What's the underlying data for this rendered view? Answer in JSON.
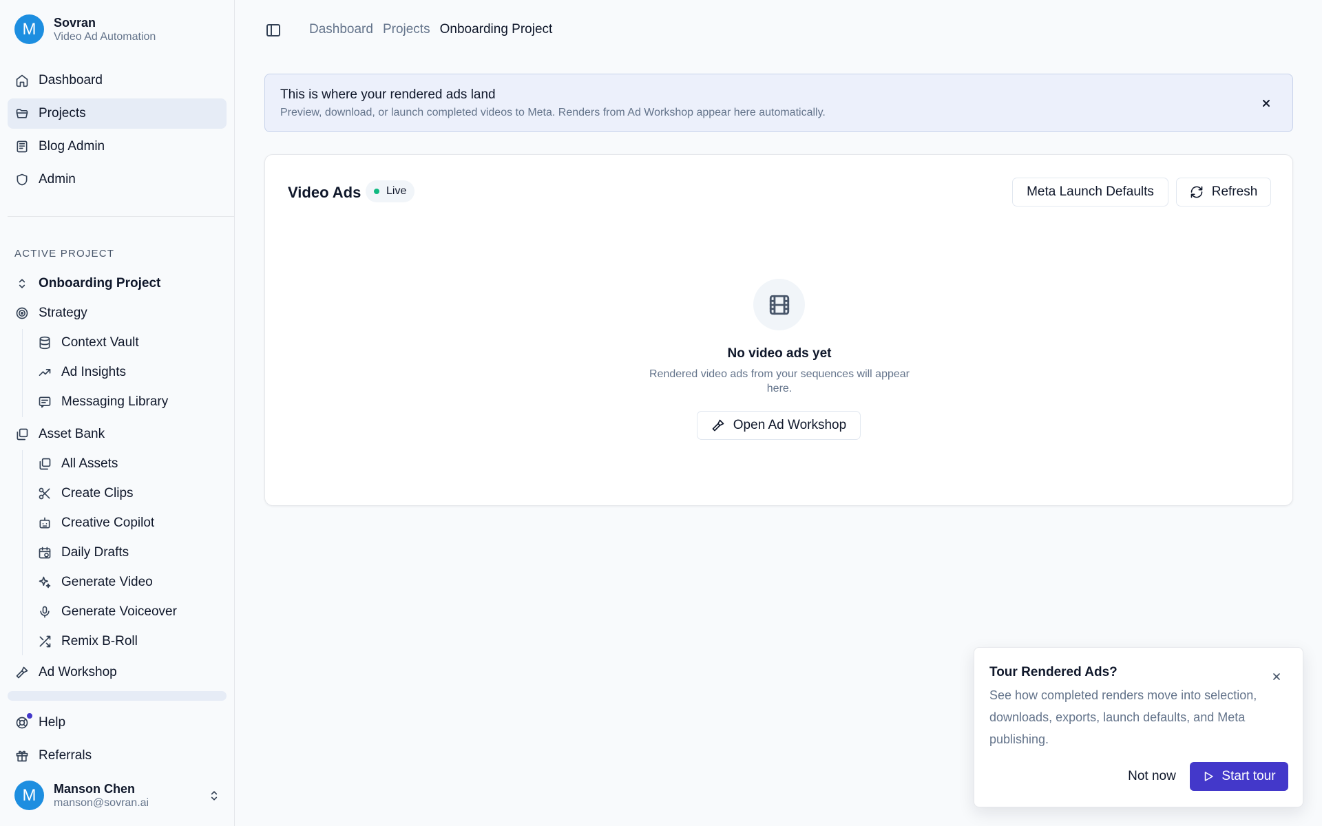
{
  "brand": {
    "initial": "M",
    "title": "Sovran",
    "subtitle": "Video Ad Automation"
  },
  "nav": {
    "main": [
      {
        "label": "Dashboard",
        "icon": "home-icon"
      },
      {
        "label": "Projects",
        "icon": "folder-icon",
        "active": true
      },
      {
        "label": "Blog Admin",
        "icon": "newspaper-icon"
      },
      {
        "label": "Admin",
        "icon": "shield-icon"
      }
    ],
    "section_label": "ACTIVE PROJECT",
    "project": {
      "label": "Onboarding Project",
      "icon": "chevrons-up-down-icon"
    },
    "strategy": {
      "label": "Strategy",
      "items": [
        "Context Vault",
        "Ad Insights",
        "Messaging Library"
      ]
    },
    "asset_bank": {
      "label": "Asset Bank",
      "items": [
        "All Assets",
        "Create Clips",
        "Creative Copilot",
        "Daily Drafts",
        "Generate Video",
        "Generate Voiceover",
        "Remix B-Roll"
      ]
    },
    "ad_workshop": "Ad Workshop",
    "help": "Help",
    "referrals": "Referrals"
  },
  "user": {
    "initial": "M",
    "name": "Manson Chen",
    "email": "manson@sovran.ai"
  },
  "breadcrumb": [
    "Dashboard",
    "Projects",
    "Onboarding Project"
  ],
  "banner": {
    "title": "This is where your rendered ads land",
    "text": "Preview, download, or launch completed videos to Meta. Renders from Ad Workshop appear here automatically."
  },
  "card": {
    "title": "Video Ads",
    "badge": "Live",
    "meta_button": "Meta Launch Defaults",
    "refresh_button": "Refresh",
    "empty_title": "No video ads yet",
    "empty_text": "Rendered video ads from your sequences will appear here.",
    "workshop_button": "Open Ad Workshop"
  },
  "tour": {
    "title": "Tour Rendered Ads?",
    "body": "See how completed renders move into selection, downloads, exports, launch defaults, and Meta publishing.",
    "not_now": "Not now",
    "start": "Start tour"
  },
  "colors": {
    "accent": "#4338ca",
    "avatar": "#1d8ee0",
    "live": "#10b981",
    "active_nav": "#e6ecf6"
  }
}
